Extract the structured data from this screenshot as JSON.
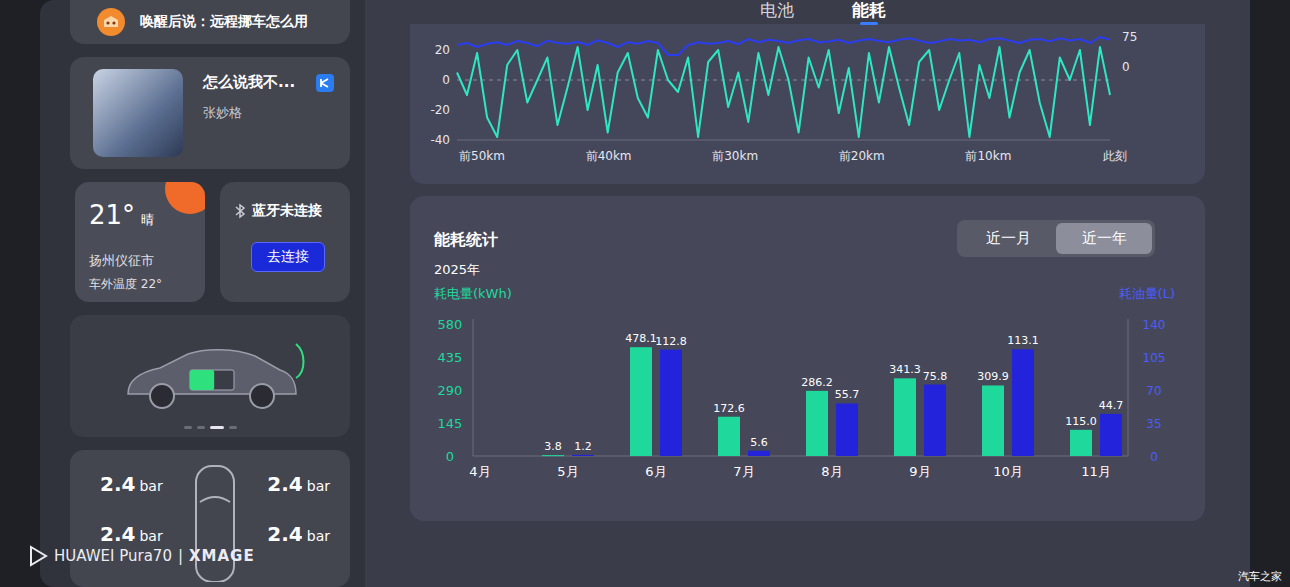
{
  "voice_tip": {
    "text": "唤醒后说：远程挪车怎么用"
  },
  "music": {
    "title": "怎么说我不...",
    "artist": "张妙格"
  },
  "weather": {
    "temperature": "21°",
    "condition": "晴",
    "city": "扬州仪征市",
    "outside_temp": "车外温度 22°"
  },
  "bluetooth": {
    "status": "蓝牙未连接",
    "button": "去连接"
  },
  "car_card": {
    "battery_level": 0.55,
    "pages": [
      {
        "selected": false
      },
      {
        "selected": false
      },
      {
        "selected": true
      },
      {
        "selected": false
      }
    ]
  },
  "tires": [
    {
      "value": "2.4",
      "unit": "bar"
    },
    {
      "value": "2.4",
      "unit": "bar"
    },
    {
      "value": "2.4",
      "unit": "bar"
    },
    {
      "value": "2.4",
      "unit": "bar"
    }
  ],
  "tabs": [
    {
      "label": "电池",
      "selected": false
    },
    {
      "label": "能耗",
      "selected": true
    }
  ],
  "trend_chart": {
    "left_ticks": [
      "20",
      "0",
      "-20",
      "-40"
    ],
    "right_ticks": [
      "75",
      "0"
    ],
    "x_labels": [
      "前50km",
      "前40km",
      "前30km",
      "前20km",
      "前10km",
      "此刻"
    ],
    "series": [
      {
        "color": "#2fe6c3",
        "values": [
          5,
          -10,
          18,
          -25,
          -38,
          10,
          20,
          -15,
          0,
          15,
          -30,
          -5,
          22,
          -20,
          10,
          -35,
          5,
          18,
          -12,
          -25,
          20,
          0,
          -8,
          15,
          -38,
          12,
          20,
          -18,
          5,
          -28,
          18,
          -10,
          22,
          0,
          -35,
          15,
          -5,
          20,
          -22,
          8,
          -38,
          18,
          -15,
          22,
          -5,
          -30,
          12,
          20,
          -20,
          0,
          18,
          -38,
          10,
          -12,
          22,
          -25,
          5,
          20,
          -15,
          -38,
          15,
          0,
          20,
          -30,
          22,
          -10
        ]
      },
      {
        "color": "#2b3df0",
        "values": [
          55,
          60,
          50,
          58,
          62,
          55,
          65,
          60,
          52,
          66,
          60,
          58,
          63,
          55,
          67,
          60,
          50,
          62,
          58,
          65,
          60,
          30,
          30,
          55,
          62,
          58,
          60,
          65,
          57,
          70,
          62,
          68,
          65,
          60,
          67,
          70,
          62,
          64,
          68,
          60,
          66,
          70,
          65,
          62,
          68,
          72,
          66,
          60,
          64,
          70,
          66,
          68,
          62,
          70,
          72,
          66,
          60,
          68,
          70,
          64,
          72,
          66,
          70,
          60,
          75,
          68
        ]
      }
    ]
  },
  "stats": {
    "title": "能耗统计",
    "year": "2025年",
    "ranges": [
      {
        "label": "近一月",
        "selected": false
      },
      {
        "label": "近一年",
        "selected": true
      }
    ],
    "left_axis_title": "耗电量(kWh)",
    "right_axis_title": "耗油量(L)",
    "left_ticks": [
      "580",
      "435",
      "290",
      "145",
      "0"
    ],
    "right_ticks": [
      "140",
      "105",
      "70",
      "35",
      "0"
    ],
    "kwh_color": "#1ed99b",
    "fuel_color": "#2323dc",
    "months": [
      {
        "label": "4月",
        "kwh": null,
        "kwh_text": null,
        "fuel": null,
        "fuel_text": null
      },
      {
        "label": "5月",
        "kwh": 3.8,
        "kwh_text": "3.8",
        "fuel": 1.2,
        "fuel_text": "1.2"
      },
      {
        "label": "6月",
        "kwh": 478.1,
        "kwh_text": "478.1",
        "fuel": 112.8,
        "fuel_text": "112.8"
      },
      {
        "label": "7月",
        "kwh": 172.6,
        "kwh_text": "172.6",
        "fuel": 5.6,
        "fuel_text": "5.6"
      },
      {
        "label": "8月",
        "kwh": 286.2,
        "kwh_text": "286.2",
        "fuel": 55.7,
        "fuel_text": "55.7"
      },
      {
        "label": "9月",
        "kwh": 341.3,
        "kwh_text": "341.3",
        "fuel": 75.8,
        "fuel_text": "75.8"
      },
      {
        "label": "10月",
        "kwh": 309.9,
        "kwh_text": "309.9",
        "fuel": 113.1,
        "fuel_text": "113.1"
      },
      {
        "label": "11月",
        "kwh": 115.0,
        "kwh_text": "115.0",
        "fuel": 44.7,
        "fuel_text": "44.7"
      }
    ]
  },
  "watermark": {
    "brand": "HUAWEI Pura70",
    "separator": "|",
    "sub": "XMAGE"
  },
  "source_mark": "汽车之家"
}
